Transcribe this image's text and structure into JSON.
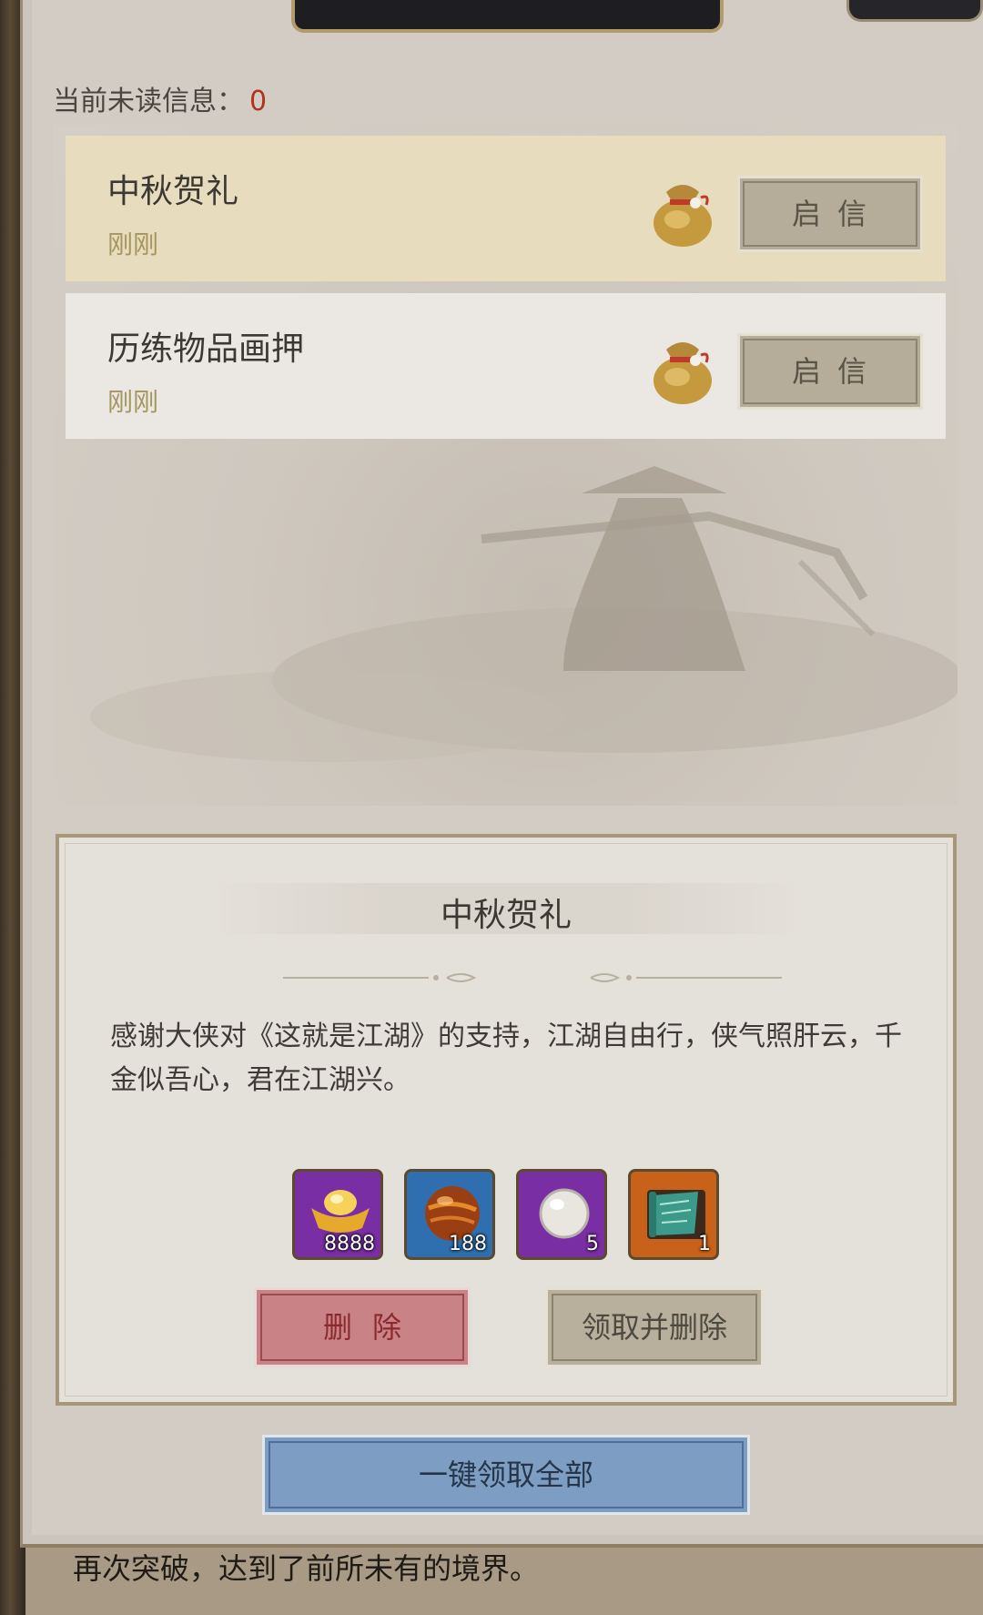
{
  "header": {
    "unread_label": "当前未读信息：",
    "unread_count": "0"
  },
  "mails": [
    {
      "title": "中秋贺礼",
      "time": "刚刚",
      "open_label": "启信",
      "selected": true
    },
    {
      "title": "历练物品画押",
      "time": "刚刚",
      "open_label": "启信",
      "selected": false
    }
  ],
  "detail": {
    "title": "中秋贺礼",
    "body": "感谢大侠对《这就是江湖》的支持，江湖自由行，侠气照肝云，千金似吾心，君在江湖兴。",
    "rewards": [
      {
        "icon": "gold-ingot-icon",
        "count": "8888",
        "frame": "#9b3fc4"
      },
      {
        "icon": "amber-orb-icon",
        "count": "188",
        "frame": "#3d8fd6"
      },
      {
        "icon": "pearl-icon",
        "count": "5",
        "frame": "#9b3fc4"
      },
      {
        "icon": "scroll-icon",
        "count": "1",
        "frame": "#d9731f"
      }
    ],
    "delete_label": "删除",
    "take_delete_label": "领取并删除"
  },
  "footer": {
    "claim_all_label": "一键领取全部"
  },
  "background": {
    "text_line1": "再次突破，达到了前所未有的境界。"
  },
  "colors": {
    "unread_count": "#b0321f",
    "selected_row": "#e8dcbe",
    "delete_button": "#c98386",
    "claim_all_button": "#7d9dc2"
  }
}
